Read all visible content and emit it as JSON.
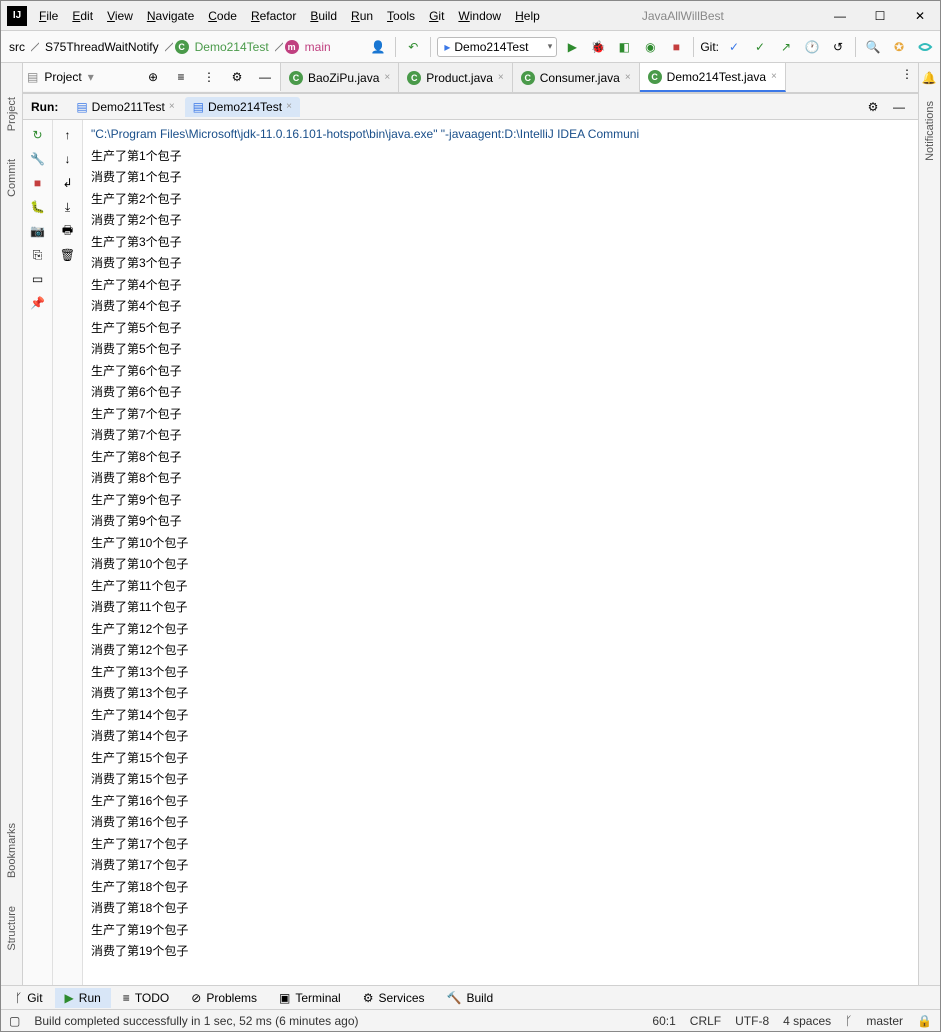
{
  "window": {
    "project": "JavaAllWillBest"
  },
  "menu": [
    "File",
    "Edit",
    "View",
    "Navigate",
    "Code",
    "Refactor",
    "Build",
    "Run",
    "Tools",
    "Git",
    "Window",
    "Help"
  ],
  "breadcrumb": {
    "src": "src",
    "pkg": "S75ThreadWaitNotify",
    "cls": "Demo214Test",
    "mth": "main"
  },
  "runConfig": "Demo214Test",
  "gitLabel": "Git:",
  "projectTool": {
    "label": "Project"
  },
  "editorTabs": [
    {
      "name": "BaoZiPu.java",
      "active": false
    },
    {
      "name": "Product.java",
      "active": false
    },
    {
      "name": "Consumer.java",
      "active": false
    },
    {
      "name": "Demo214Test.java",
      "active": true
    }
  ],
  "runLabel": "Run:",
  "runTabs": [
    {
      "name": "Demo211Test",
      "active": false
    },
    {
      "name": "Demo214Test",
      "active": true
    }
  ],
  "console": {
    "cmd": "\"C:\\Program Files\\Microsoft\\jdk-11.0.16.101-hotspot\\bin\\java.exe\" \"-javaagent:D:\\IntelliJ IDEA Communi",
    "lines": [
      "生产了第1个包子",
      "消费了第1个包子",
      "生产了第2个包子",
      "消费了第2个包子",
      "生产了第3个包子",
      "消费了第3个包子",
      "生产了第4个包子",
      "消费了第4个包子",
      "生产了第5个包子",
      "消费了第5个包子",
      "生产了第6个包子",
      "消费了第6个包子",
      "生产了第7个包子",
      "消费了第7个包子",
      "生产了第8个包子",
      "消费了第8个包子",
      "生产了第9个包子",
      "消费了第9个包子",
      "生产了第10个包子",
      "消费了第10个包子",
      "生产了第11个包子",
      "消费了第11个包子",
      "生产了第12个包子",
      "消费了第12个包子",
      "生产了第13个包子",
      "消费了第13个包子",
      "生产了第14个包子",
      "消费了第14个包子",
      "生产了第15个包子",
      "消费了第15个包子",
      "生产了第16个包子",
      "消费了第16个包子",
      "生产了第17个包子",
      "消费了第17个包子",
      "生产了第18个包子",
      "消费了第18个包子",
      "生产了第19个包子",
      "消费了第19个包子"
    ]
  },
  "leftTools": {
    "project": "Project",
    "commit": "Commit",
    "bookmarks": "Bookmarks",
    "structure": "Structure"
  },
  "rightTools": {
    "notifications": "Notifications"
  },
  "bottomTabs": [
    {
      "icon": "branch",
      "label": "Git"
    },
    {
      "icon": "play",
      "label": "Run",
      "active": true
    },
    {
      "icon": "list",
      "label": "TODO"
    },
    {
      "icon": "warn",
      "label": "Problems"
    },
    {
      "icon": "term",
      "label": "Terminal"
    },
    {
      "icon": "gear",
      "label": "Services"
    },
    {
      "icon": "hammer",
      "label": "Build"
    }
  ],
  "status": {
    "msg": "Build completed successfully in 1 sec, 52 ms (6 minutes ago)",
    "pos": "60:1",
    "ln": "CRLF",
    "enc": "UTF-8",
    "indent": "4 spaces",
    "branch": "master"
  }
}
